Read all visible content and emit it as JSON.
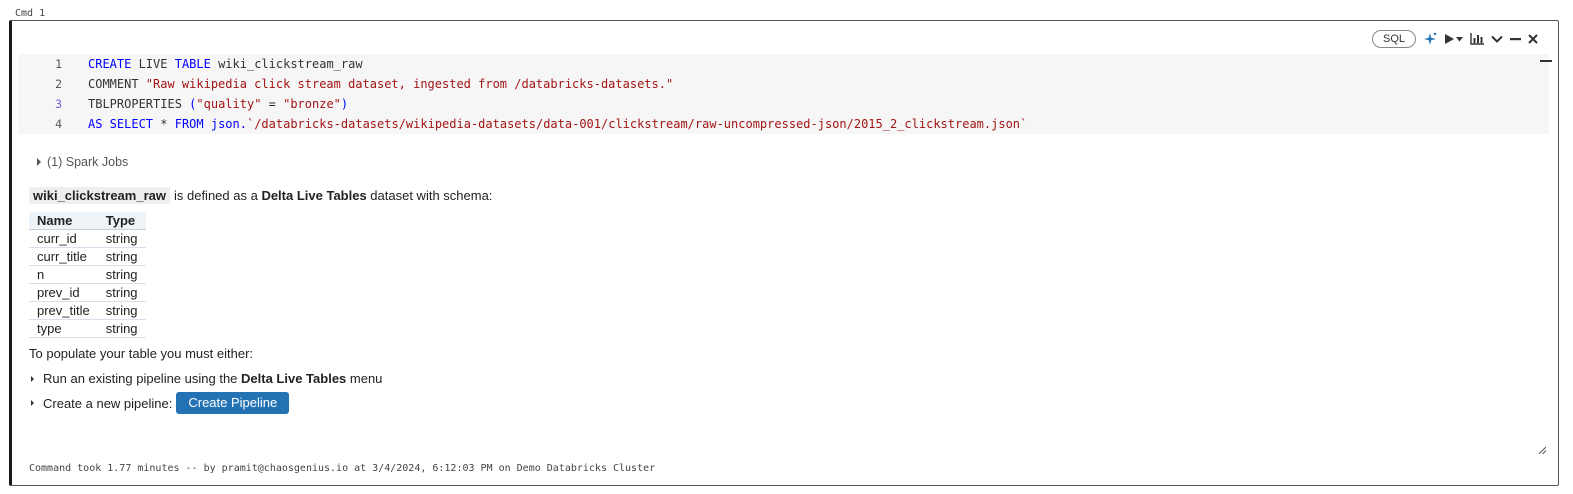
{
  "cmd_label": "Cmd 1",
  "toolbar": {
    "language": "SQL",
    "icons": [
      "assistant-sparkle-icon",
      "run-icon",
      "run-dropdown-icon",
      "chart-icon",
      "collapse-chevron-icon",
      "minimize-icon",
      "close-icon"
    ]
  },
  "code_lines": [
    {
      "num": "1",
      "segments": [
        {
          "t": "CREATE",
          "c": "kw"
        },
        {
          "t": " LIVE ",
          "c": "pl"
        },
        {
          "t": "TABLE",
          "c": "kw"
        },
        {
          "t": " wiki_clickstream_raw",
          "c": "pl"
        }
      ]
    },
    {
      "num": "2",
      "segments": [
        {
          "t": "COMMENT ",
          "c": "pl"
        },
        {
          "t": "\"Raw wikipedia click stream dataset, ingested from /databricks-datasets.\"",
          "c": "str"
        }
      ]
    },
    {
      "num": "3",
      "segments": [
        {
          "t": "TBLPROPERTIES ",
          "c": "pl"
        },
        {
          "t": "(",
          "c": "kw"
        },
        {
          "t": "\"quality\"",
          "c": "str"
        },
        {
          "t": " = ",
          "c": "pl"
        },
        {
          "t": "\"bronze\"",
          "c": "str"
        },
        {
          "t": ")",
          "c": "kw"
        }
      ]
    },
    {
      "num": "4",
      "segments": [
        {
          "t": "AS SELECT",
          "c": "kw"
        },
        {
          "t": " * ",
          "c": "pl"
        },
        {
          "t": "FROM",
          "c": "kw"
        },
        {
          "t": " json.",
          "c": "kw"
        },
        {
          "t": "`/databricks-datasets/wikipedia-datasets/data-001/clickstream/raw-uncompressed-json/2015_2_clickstream.json`",
          "c": "str"
        }
      ]
    }
  ],
  "spark_jobs": "(1) Spark Jobs",
  "output": {
    "table_name": "wiki_clickstream_raw",
    "desc_pre": "is defined as a ",
    "desc_bold": "Delta Live Tables",
    "desc_post": " dataset with schema:",
    "schema_headers": [
      "Name",
      "Type"
    ],
    "schema_rows": [
      [
        "curr_id",
        "string"
      ],
      [
        "curr_title",
        "string"
      ],
      [
        "n",
        "string"
      ],
      [
        "prev_id",
        "string"
      ],
      [
        "prev_title",
        "string"
      ],
      [
        "type",
        "string"
      ]
    ],
    "populate_text": "To populate your table you must either:",
    "bullet1_pre": "Run an existing pipeline using the ",
    "bullet1_bold": "Delta Live Tables",
    "bullet1_post": " menu",
    "bullet2_pre": "Create a new pipeline:",
    "create_button": "Create Pipeline"
  },
  "footer": "Command took 1.77 minutes -- by pramit@chaosgenius.io at 3/4/2024, 6:12:03 PM on Demo Databricks Cluster"
}
